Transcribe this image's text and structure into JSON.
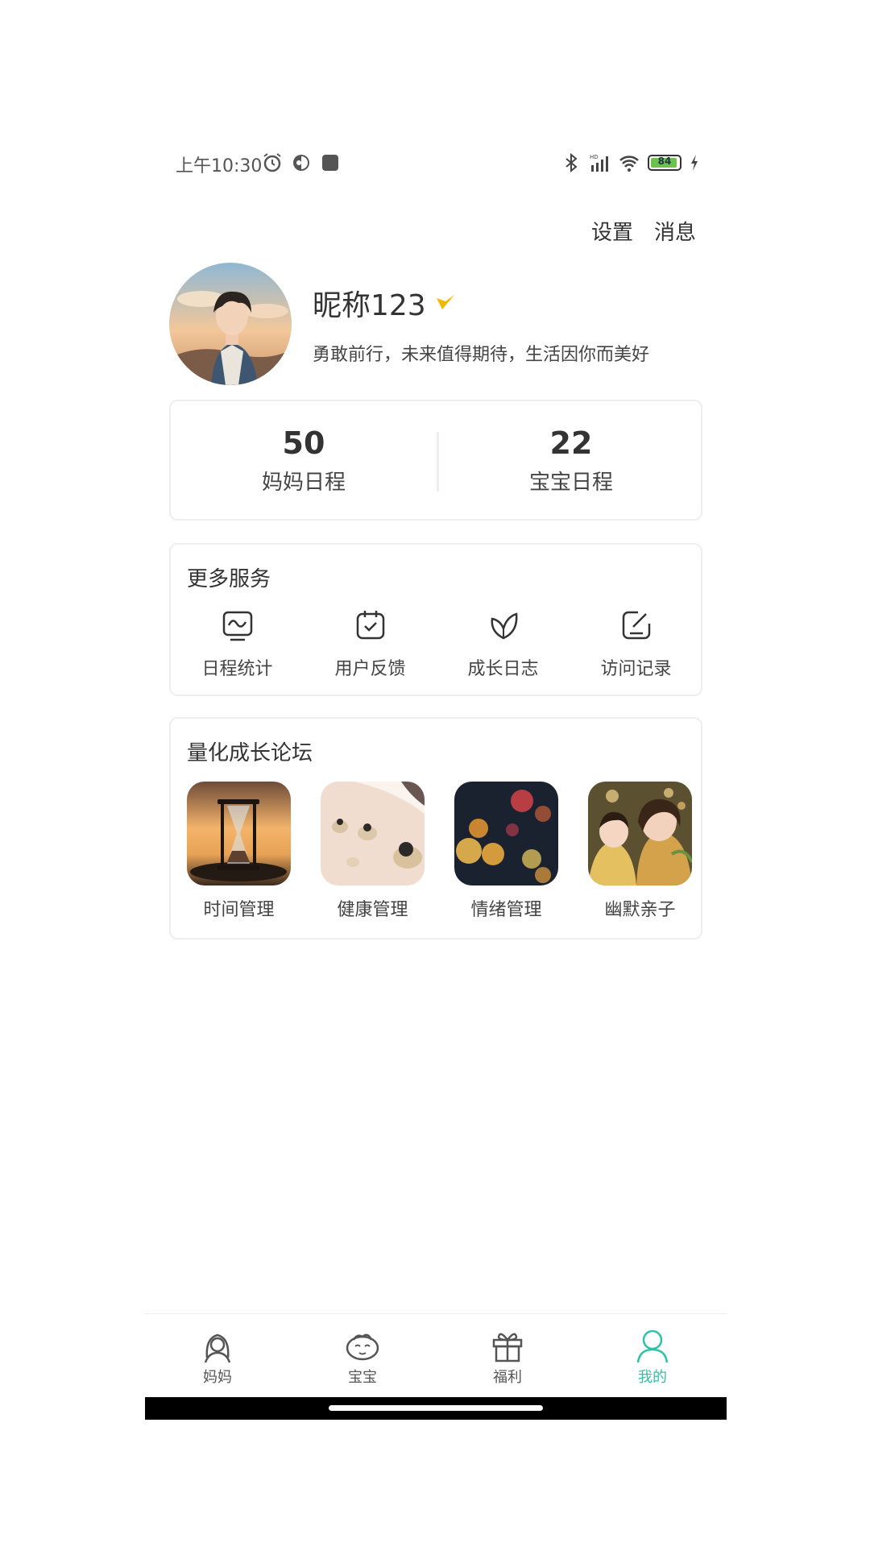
{
  "status_bar": {
    "time": "上午10:30",
    "battery": "84"
  },
  "header": {
    "settings_label": "设置",
    "messages_label": "消息"
  },
  "profile": {
    "nickname": "昵称123",
    "motto": "勇敢前行，未来值得期待，生活因你而美好"
  },
  "stats": [
    {
      "value": "50",
      "label": "妈妈日程"
    },
    {
      "value": "22",
      "label": "宝宝日程"
    }
  ],
  "services": {
    "title": "更多服务",
    "items": [
      {
        "label": "日程统计",
        "icon": "chart-screen-icon"
      },
      {
        "label": "用户反馈",
        "icon": "calendar-check-icon"
      },
      {
        "label": "成长日志",
        "icon": "leaf-icon"
      },
      {
        "label": "访问记录",
        "icon": "edit-icon"
      }
    ]
  },
  "forum": {
    "title": "量化成长论坛",
    "items": [
      {
        "label": "时间管理",
        "icon": "hourglass-photo"
      },
      {
        "label": "健康管理",
        "icon": "food-photo"
      },
      {
        "label": "情绪管理",
        "icon": "rainy-window-photo"
      },
      {
        "label": "幽默亲子",
        "icon": "mother-child-photo"
      }
    ]
  },
  "tabbar": {
    "items": [
      {
        "label": "妈妈",
        "icon": "mother-icon"
      },
      {
        "label": "宝宝",
        "icon": "baby-icon"
      },
      {
        "label": "福利",
        "icon": "gift-icon"
      },
      {
        "label": "我的",
        "icon": "user-icon"
      }
    ],
    "active_index": 3
  },
  "colors": {
    "accent": "#2ec2a6",
    "badge": "#f2b800",
    "card_border": "#eeeeee"
  }
}
